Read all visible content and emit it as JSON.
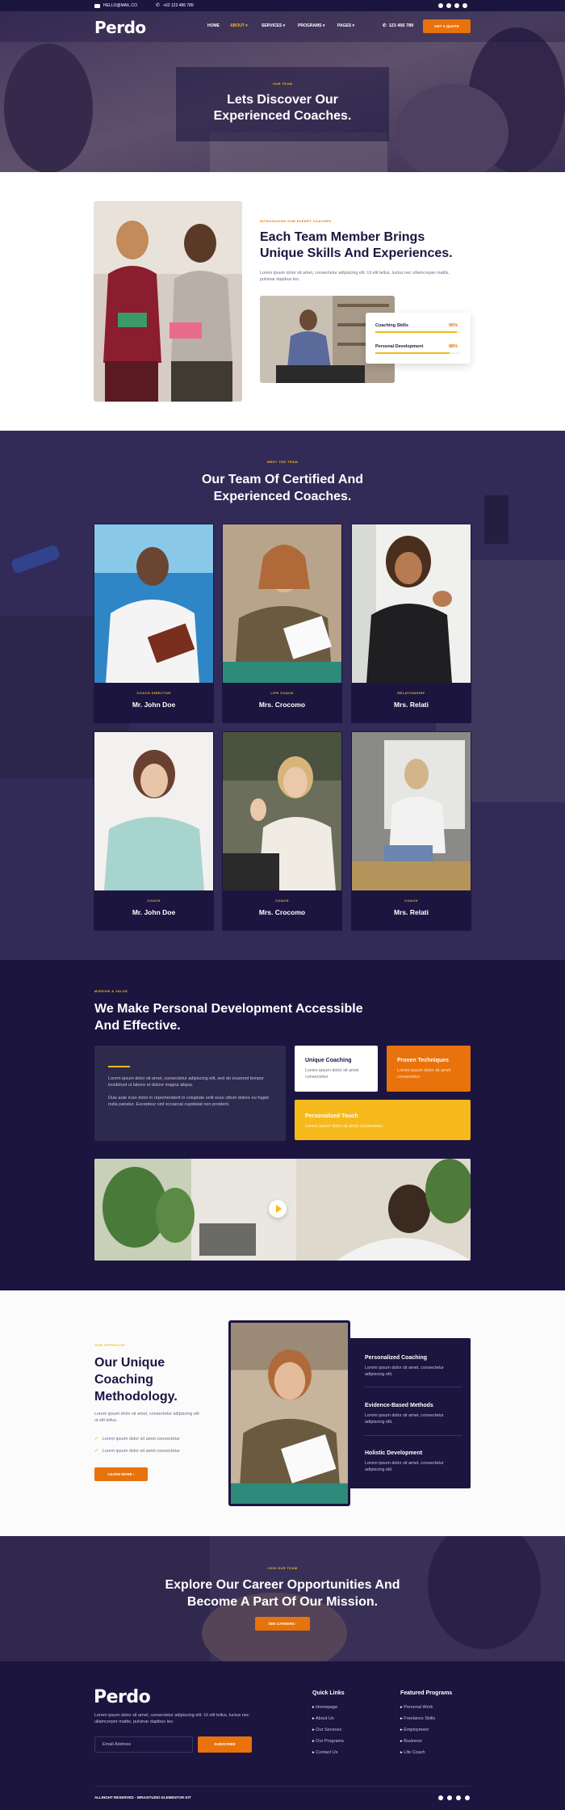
{
  "topbar": {
    "email": "HELLO@MAIL.CO",
    "phone": "+62 123 486 789"
  },
  "nav": {
    "logo": "Perdo",
    "items": [
      "HOME",
      "ABOUT",
      "SERVICES",
      "PROGRAMS",
      "PAGES"
    ],
    "phone": "123 456 789",
    "cta": "GET A QUOTE"
  },
  "hero": {
    "kicker": "OUR TEAM",
    "title": "Lets Discover Our Experienced Coaches."
  },
  "about": {
    "kicker": "INTRODUCING OUR EXPERT COACHES",
    "title": "Each Team Member Brings Unique Skills And Experiences.",
    "text": "Lorem ipsum dolor sit amet, consectetur adipiscing elit. Ut elit tellus, luctus nec ullamcorper mattis, pulvinar dapibus leo.",
    "skills": [
      {
        "label": "Coaching Skills",
        "value": "96%",
        "pct": 0.96
      },
      {
        "label": "Personal Development",
        "value": "88%",
        "pct": 0.88
      }
    ]
  },
  "team": {
    "kicker": "MEET THE TEAM",
    "title": "Our Team Of Certified And Experienced Coaches.",
    "members": [
      {
        "role": "COACH DIRECTOR",
        "name": "Mr. John Doe"
      },
      {
        "role": "LIFE COACH",
        "name": "Mrs. Crocomo"
      },
      {
        "role": "RELATIONSHIP",
        "name": "Mrs. Relati"
      },
      {
        "role": "COACH",
        "name": "Mr. John Doe"
      },
      {
        "role": "COACH",
        "name": "Mrs. Crocomo"
      },
      {
        "role": "COACH",
        "name": "Mrs. Relati"
      }
    ]
  },
  "mission": {
    "kicker": "MISSION & VALUE",
    "title": "We Make Personal Development Accessible And Effective.",
    "p1": "Lorem ipsum dolor sit amet, consectetur adipiscing elit, sed do eiusmod tempor incididunt ut labore et dolore magna aliqua.",
    "p2": "Duis aute irure dolor in reprehenderit in voluptate velit esse cillum dolore eu fugiat nulla pariatur. Excepteur sint occaecat cupidatat non proident.",
    "boxes": [
      {
        "title": "Unique Coaching",
        "text": "Lorem ipsum dolor sit amet consectetur"
      },
      {
        "title": "Proven Techniques",
        "text": "Lorem ipsum dolor sit amet consectetur"
      },
      {
        "title": "Personalized Touch",
        "text": "Lorem ipsum dolor sit amet consectetur"
      }
    ]
  },
  "method": {
    "kicker": "OUR APPROACH",
    "title": "Our Unique Coaching Methodology.",
    "text": "Lorem ipsum dolor sit amet, consectetur adipiscing elit ut elit tellus.",
    "checks": [
      "Lorem ipsum dolor sit amet consectetur",
      "Lorem ipsum dolor sit amet consectetur"
    ],
    "btn": "LEARN MORE",
    "items": [
      {
        "title": "Personalized Coaching",
        "text": "Lorem ipsum dolor sit amet, consectetur adipiscing elit."
      },
      {
        "title": "Evidence-Based Methods",
        "text": "Lorem ipsum dolor sit amet, consectetur adipiscing elit."
      },
      {
        "title": "Holistic Development",
        "text": "Lorem ipsum dolor sit amet, consectetur adipiscing elit."
      }
    ]
  },
  "career": {
    "kicker": "JOIN OUR TEAM",
    "title": "Explore Our Career Opportunities And Become A Part Of Our Mission.",
    "btn": "SEE CAREERS"
  },
  "footer": {
    "logo": "Perdo",
    "text": "Lorem ipsum dolor sit amet, consectetur adipiscing elit. Ut elit tellus, luctus nec ullamcorper mattis, pulvinar dapibus leo.",
    "email_placeholder": "Email Address",
    "subscribe": "SUBSCRIBE",
    "quick_title": "Quick Links",
    "quick": [
      "Homepage",
      "About Us",
      "Our Services",
      "Our Programs",
      "Contact Us"
    ],
    "feat_title": "Featured Programs",
    "feat": [
      "Personal Work",
      "Freelance Skills",
      "Employment",
      "Business",
      "Life Coach"
    ],
    "copyright": "ALLRIGHT RESERVED - WRAISTUDIO ELEMENTOR KIT"
  },
  "colors": {
    "navy": "#1b1540",
    "orange": "#e8720c",
    "yellow": "#f6b91c"
  }
}
